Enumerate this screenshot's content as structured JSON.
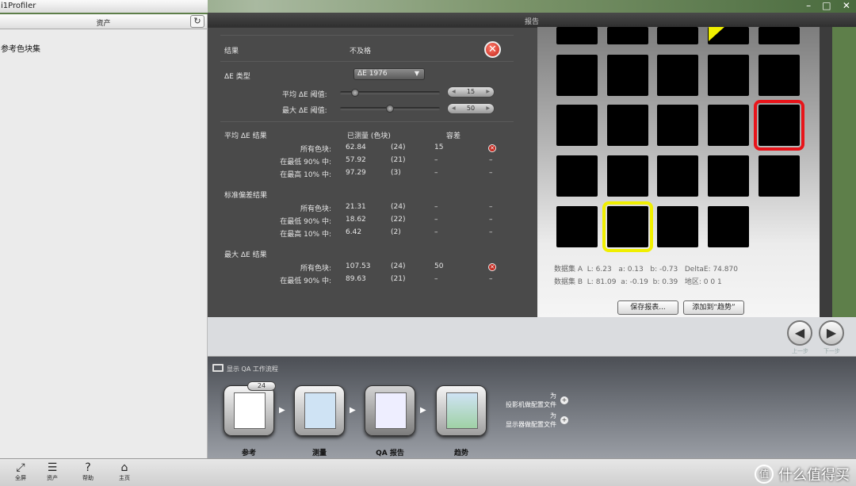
{
  "app": {
    "title": "i1Profiler"
  },
  "left": {
    "header": "资产",
    "section": "参考色块集"
  },
  "center": {
    "header": "报告"
  },
  "results": {
    "result_label": "结果",
    "result_value": "不及格",
    "de_type_label": "ΔE 类型",
    "de_type_value": "ΔE 1976",
    "avg_threshold_label": "平均 ΔE 阈值:",
    "avg_threshold_value": "15",
    "avg_threshold_fraction": 0.15,
    "max_threshold_label": "最大 ΔE 阈值:",
    "max_threshold_value": "50",
    "max_threshold_fraction": 0.5,
    "col_measured": "已测量 (色块)",
    "col_tolerance": "容差",
    "groups": [
      {
        "title": "平均 ΔE 结果",
        "rows": [
          {
            "label": "所有色块:",
            "value": "62.84",
            "count": "(24)",
            "tol": "15",
            "status": "fail"
          },
          {
            "label": "在最低 90% 中:",
            "value": "57.92",
            "count": "(21)",
            "tol": "–",
            "status": "–"
          },
          {
            "label": "在最高 10% 中:",
            "value": "97.29",
            "count": "(3)",
            "tol": "–",
            "status": "–"
          }
        ]
      },
      {
        "title": "标准偏差结果",
        "rows": [
          {
            "label": "所有色块:",
            "value": "21.31",
            "count": "(24)",
            "tol": "–",
            "status": "–"
          },
          {
            "label": "在最低 90% 中:",
            "value": "18.62",
            "count": "(22)",
            "tol": "–",
            "status": "–"
          },
          {
            "label": "在最高 10% 中:",
            "value": "6.42",
            "count": "(2)",
            "tol": "–",
            "status": "–"
          }
        ]
      },
      {
        "title": "最大 ΔE 结果",
        "rows": [
          {
            "label": "所有色块:",
            "value": "107.53",
            "count": "(24)",
            "tol": "50",
            "status": "fail"
          },
          {
            "label": "在最低 90% 中:",
            "value": "89.63",
            "count": "(21)",
            "tol": "–",
            "status": "–"
          }
        ]
      }
    ]
  },
  "swatches": {
    "dataset_a": {
      "label": "数据集 A",
      "L": "L: 6.23",
      "a": "a: 0.13",
      "b": "b: -0.73",
      "extra": "DeltaE: 74.870"
    },
    "dataset_b": {
      "label": "数据集 B",
      "L": "L: 81.09",
      "a": "a: -0.19",
      "b": "b: 0.39",
      "extra": "地区: 0 0 1"
    },
    "save_report": "保存报表...",
    "add_to_trend": "添加到“趋势”",
    "highlight_red": "#e8141a",
    "highlight_yellow": "#f0ef00"
  },
  "nav": {
    "prev": "上一步",
    "next": "下一步"
  },
  "workflow": {
    "title": "显示 QA 工作流程",
    "stages": [
      {
        "label": "参考",
        "badge": "24"
      },
      {
        "label": "测量"
      },
      {
        "label": "QA 报告"
      },
      {
        "label": "趋势"
      }
    ],
    "options": [
      {
        "line1": "为",
        "line2": "投影机做配置文件"
      },
      {
        "line1": "为",
        "line2": "显示器做配置文件"
      }
    ]
  },
  "bottombar": {
    "items": [
      "全屏",
      "资产",
      "帮助",
      "主页"
    ]
  },
  "watermark": {
    "text": "什么值得买",
    "logo": "值"
  }
}
